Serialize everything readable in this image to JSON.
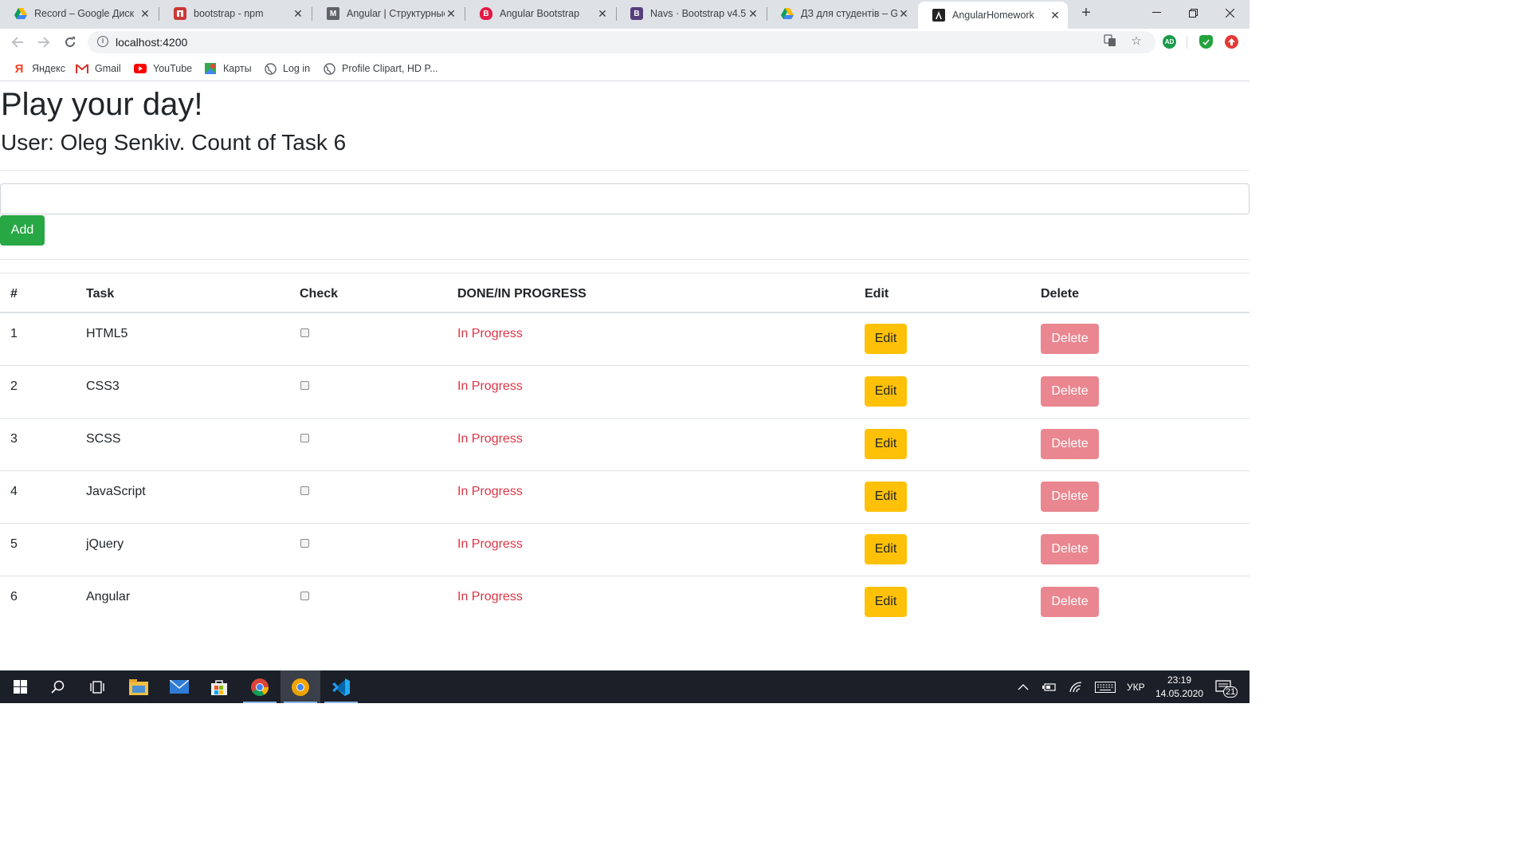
{
  "browser": {
    "tabs": [
      {
        "title": "Record – Google Диск",
        "icon": "google-drive-icon",
        "active": false
      },
      {
        "title": "bootstrap - npm",
        "icon": "npm-icon",
        "active": false
      },
      {
        "title": "Angular | Структурные",
        "icon": "gmail-icon",
        "active": false
      },
      {
        "title": "Angular Bootstrap",
        "icon": "ng-bootstrap-icon",
        "active": false
      },
      {
        "title": "Navs · Bootstrap v4.5",
        "icon": "bootstrap-icon",
        "active": false
      },
      {
        "title": "ДЗ для студентів – Goo",
        "icon": "google-drive-icon",
        "active": false
      },
      {
        "title": "AngularHomework",
        "icon": "angular-icon",
        "active": true
      }
    ],
    "url": "localhost:4200",
    "bookmarks": [
      {
        "label": "Яндекс",
        "icon": "yandex-icon"
      },
      {
        "label": "Gmail",
        "icon": "gmail-icon"
      },
      {
        "label": "YouTube",
        "icon": "youtube-icon"
      },
      {
        "label": "Карты",
        "icon": "maps-icon"
      },
      {
        "label": "Log in",
        "icon": "globe-icon"
      },
      {
        "label": "Profile Clipart, HD P...",
        "icon": "globe-icon"
      }
    ],
    "extensions": [
      "translate-icon",
      "star-icon",
      "adguard-icon",
      "shield-check-icon",
      "update-icon"
    ],
    "extension_labels": {
      "adguard": "AD"
    }
  },
  "app": {
    "heading": "Play your day!",
    "subheading": "User: Oleg Senkiv. Count of Task 6",
    "input_value": "",
    "add_label": "Add",
    "table": {
      "headers": {
        "num": "#",
        "task": "Task",
        "check": "Check",
        "status": "DONE/IN PROGRESS",
        "edit": "Edit",
        "delete": "Delete"
      },
      "rows": [
        {
          "num": "1",
          "task": "HTML5",
          "checked": false,
          "status": "In Progress",
          "edit": "Edit",
          "delete": "Delete"
        },
        {
          "num": "2",
          "task": "CSS3",
          "checked": false,
          "status": "In Progress",
          "edit": "Edit",
          "delete": "Delete"
        },
        {
          "num": "3",
          "task": "SCSS",
          "checked": false,
          "status": "In Progress",
          "edit": "Edit",
          "delete": "Delete"
        },
        {
          "num": "4",
          "task": "JavaScript",
          "checked": false,
          "status": "In Progress",
          "edit": "Edit",
          "delete": "Delete"
        },
        {
          "num": "5",
          "task": "jQuery",
          "checked": false,
          "status": "In Progress",
          "edit": "Edit",
          "delete": "Delete"
        },
        {
          "num": "6",
          "task": "Angular",
          "checked": false,
          "status": "In Progress",
          "edit": "Edit",
          "delete": "Delete"
        }
      ]
    },
    "colors": {
      "add": "#28a745",
      "edit": "#ffc107",
      "delete": "#e9868f",
      "status": "#dc3545"
    }
  },
  "taskbar": {
    "apps": [
      "windows-start-icon",
      "search-icon",
      "task-view-icon",
      "file-explorer-icon",
      "mail-icon",
      "store-icon",
      "chrome-icon",
      "chrome-canary-icon",
      "vscode-icon"
    ],
    "language": "УКР",
    "time": "23:19",
    "date": "14.05.2020",
    "notifications": "21"
  }
}
